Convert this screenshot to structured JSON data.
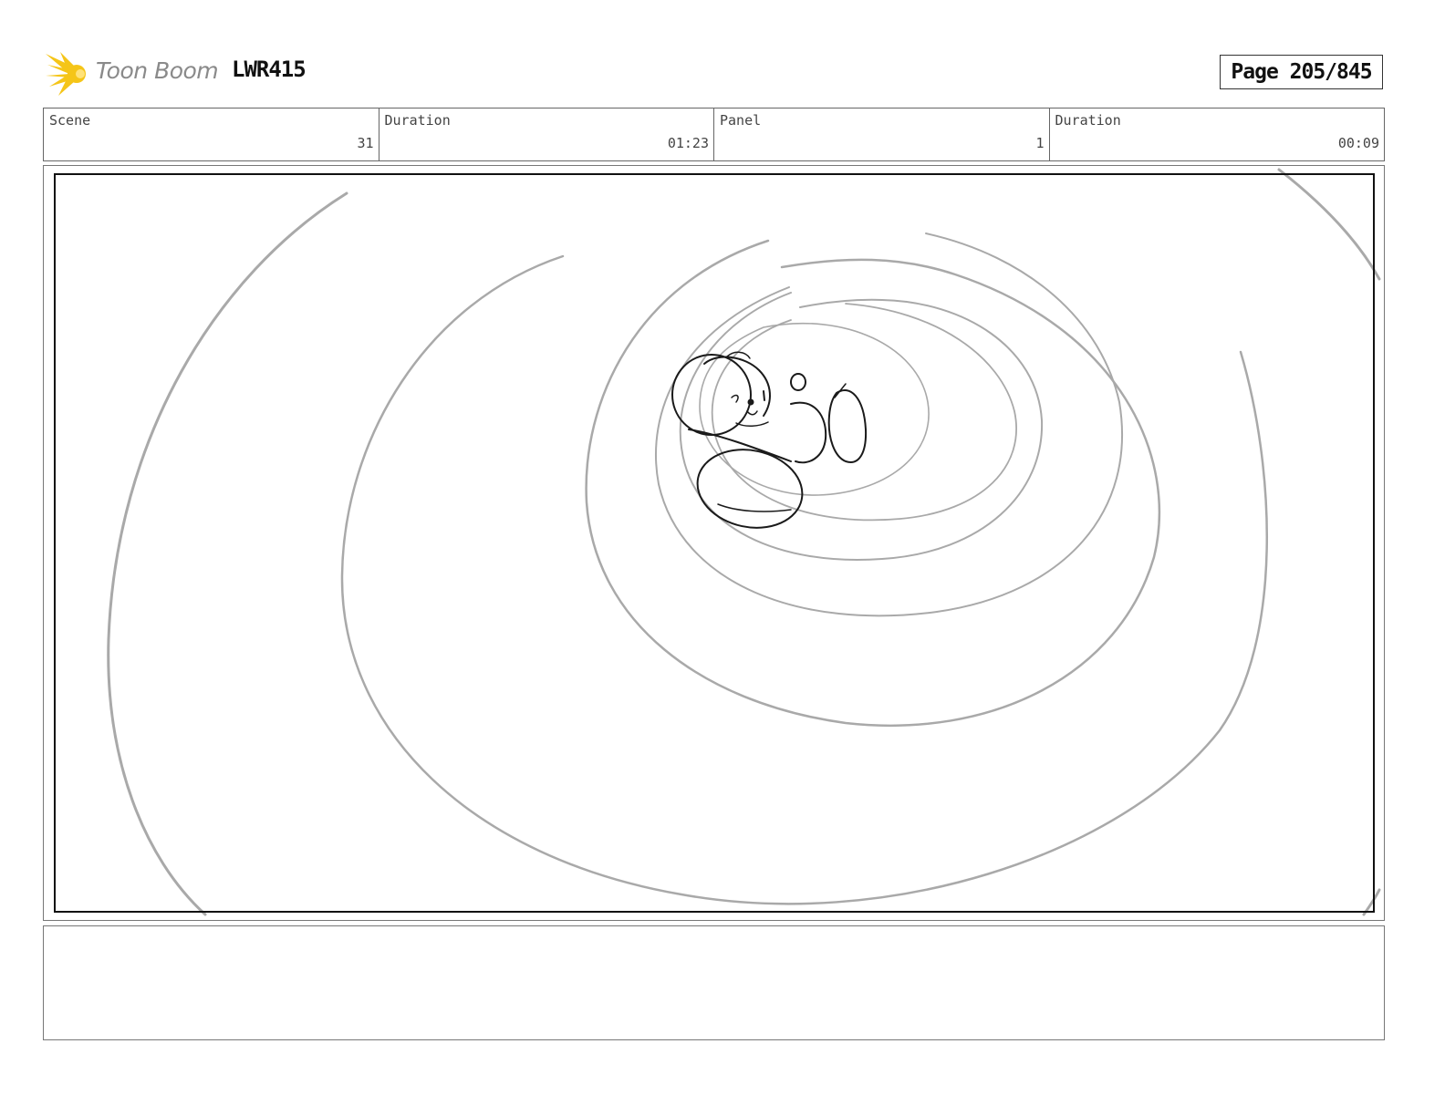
{
  "header": {
    "brand": "Toon Boom",
    "project": "LWR415",
    "page": "Page 205/845"
  },
  "info_bar": [
    {
      "label": "Scene",
      "value": "31"
    },
    {
      "label": "Duration",
      "value": "01:23"
    },
    {
      "label": "Panel",
      "value": "1"
    },
    {
      "label": "Duration",
      "value": "00:09"
    }
  ],
  "panel": {
    "sketch_icon": "storyboard-sketch-spiral-tunnel-character"
  },
  "notes": {
    "text": ""
  },
  "colors": {
    "logo_yellow": "#f5c518",
    "logo_text": "#8a8a8a",
    "sketch_gray": "#a9a9a9",
    "sketch_black": "#1a1a1a"
  }
}
